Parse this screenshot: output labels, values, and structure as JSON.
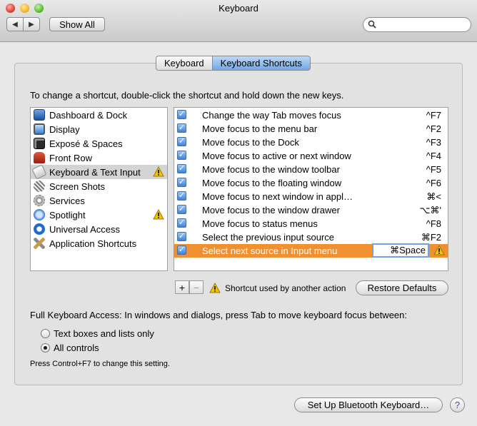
{
  "window": {
    "title": "Keyboard"
  },
  "toolbar": {
    "back": "◀",
    "forward": "▶",
    "show_all": "Show All",
    "search_placeholder": ""
  },
  "tabs": [
    {
      "label": "Keyboard",
      "active": false
    },
    {
      "label": "Keyboard Shortcuts",
      "active": true
    }
  ],
  "instructions": "To change a shortcut, double-click the shortcut and hold down the new keys.",
  "categories": [
    {
      "label": "Dashboard & Dock",
      "icon": "dashboard-dock-icon",
      "warning": false,
      "selected": false
    },
    {
      "label": "Display",
      "icon": "display-icon",
      "warning": false,
      "selected": false
    },
    {
      "label": "Exposé & Spaces",
      "icon": "expose-spaces-icon",
      "warning": false,
      "selected": false
    },
    {
      "label": "Front Row",
      "icon": "front-row-icon",
      "warning": false,
      "selected": false
    },
    {
      "label": "Keyboard & Text Input",
      "icon": "keyboard-icon",
      "warning": true,
      "selected": true
    },
    {
      "label": "Screen Shots",
      "icon": "screen-shots-icon",
      "warning": false,
      "selected": false
    },
    {
      "label": "Services",
      "icon": "services-gear-icon",
      "warning": false,
      "selected": false
    },
    {
      "label": "Spotlight",
      "icon": "spotlight-icon",
      "warning": true,
      "selected": false
    },
    {
      "label": "Universal Access",
      "icon": "universal-access-icon",
      "warning": false,
      "selected": false
    },
    {
      "label": "Application Shortcuts",
      "icon": "app-shortcuts-icon",
      "warning": false,
      "selected": false
    }
  ],
  "shortcuts": [
    {
      "action": "Change the way Tab moves focus",
      "key": "^F7",
      "checked": true,
      "selected": false
    },
    {
      "action": "Move focus to the menu bar",
      "key": "^F2",
      "checked": true,
      "selected": false
    },
    {
      "action": "Move focus to the Dock",
      "key": "^F3",
      "checked": true,
      "selected": false
    },
    {
      "action": "Move focus to active or next window",
      "key": "^F4",
      "checked": true,
      "selected": false
    },
    {
      "action": "Move focus to the window toolbar",
      "key": "^F5",
      "checked": true,
      "selected": false
    },
    {
      "action": "Move focus to the floating window",
      "key": "^F6",
      "checked": true,
      "selected": false
    },
    {
      "action": "Move focus to next window in appl…",
      "key": "⌘<",
      "checked": true,
      "selected": false
    },
    {
      "action": "Move focus to the window drawer",
      "key": "⌥⌘'",
      "checked": true,
      "selected": false
    },
    {
      "action": "Move focus to status menus",
      "key": "^F8",
      "checked": true,
      "selected": false
    },
    {
      "action": "Select the previous input source",
      "key": "⌘F2",
      "checked": true,
      "selected": false
    },
    {
      "action": "Select next source in Input menu",
      "key": "⌘Space",
      "checked": true,
      "selected": true,
      "warning": true
    }
  ],
  "controls": {
    "add": "+",
    "remove": "−",
    "legend": "Shortcut used by another action",
    "restore": "Restore Defaults"
  },
  "full_keyboard_access": {
    "label": "Full Keyboard Access: In windows and dialogs, press Tab to move keyboard focus between:",
    "options": [
      {
        "label": "Text boxes and lists only",
        "selected": false
      },
      {
        "label": "All controls",
        "selected": true
      }
    ],
    "hint": "Press Control+F7 to change this setting."
  },
  "footer": {
    "bluetooth": "Set Up Bluetooth Keyboard…",
    "help": "?"
  },
  "colors": {
    "selection_orange": "#f09030",
    "tab_active_blue": "#6ea9e8",
    "warning_yellow": "#f5c400"
  }
}
